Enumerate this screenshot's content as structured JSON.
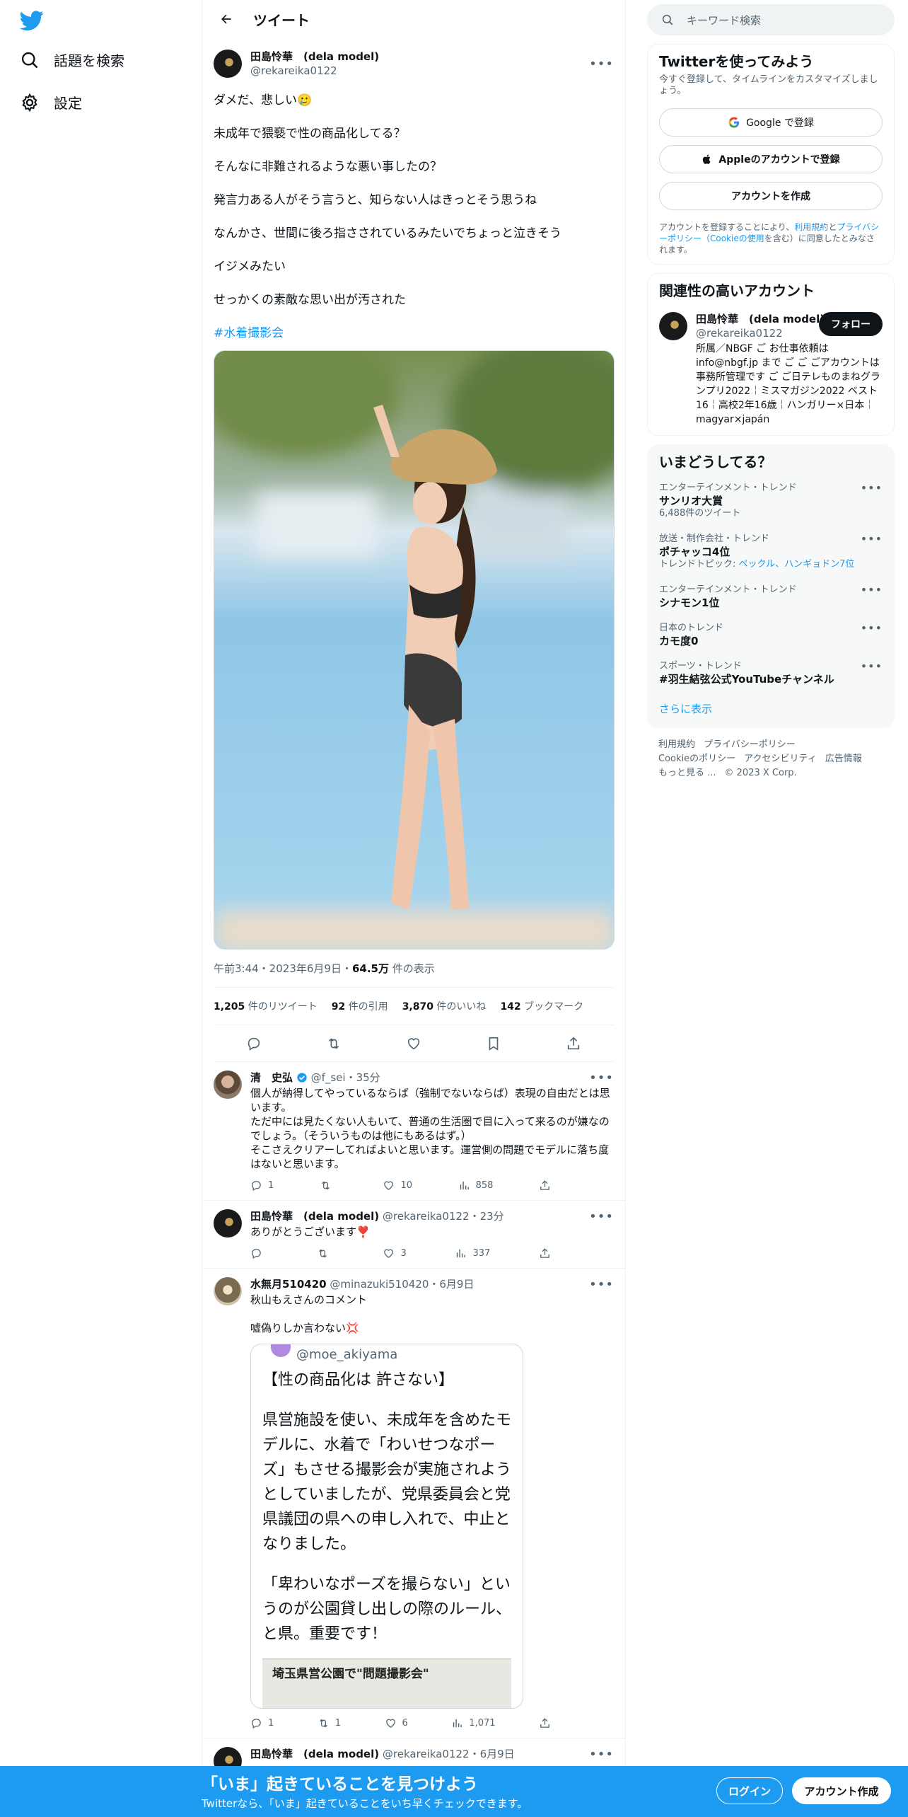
{
  "nav": {
    "explore_label": "話題を検索",
    "settings_label": "設定"
  },
  "header": {
    "title": "ツイート"
  },
  "tweet": {
    "display_name": "田島怜華　(dela model)",
    "handle": "@rekareika0122",
    "lines": [
      "ダメだ、悲しい🥲",
      "未成年で猥褻で性の商品化してる？",
      "そんなに非難されるような悪い事したの？",
      "発言力ある人がそう言うと、知らない人はきっとそう思うね",
      "なんかさ、世間に後ろ指さされているみたいでちょっと泣きそう",
      "イジメみたい",
      "せっかくの素敵な思い出が汚された"
    ],
    "hashtag": "#水着撮影会",
    "time": "午前3:44・2023年6月9日・",
    "views_count": "64.5万",
    "views_label": " 件の表示",
    "stats": [
      {
        "count": "1,205",
        "label": " 件のリツイート"
      },
      {
        "count": "92",
        "label": " 件の引用"
      },
      {
        "count": "3,870",
        "label": " 件のいいね"
      },
      {
        "count": "142",
        "label": " ブックマーク"
      }
    ]
  },
  "replies": [
    {
      "name": "清　史弘",
      "handle": "@f_sei",
      "time": "・35分",
      "body": "個人が納得してやっているならば（強制でないならば）表現の自由だとは思います。\nただ中には見たくない人もいて、普通の生活圏で目に入って来るのが嫌なのでしょう。（そういうものは他にもあるはず。）\nそこさえクリアーしてればよいと思います。運営側の問題でモデルに落ち度はないと思います。",
      "replies": "1",
      "retweets": "",
      "likes": "10",
      "views": "858"
    },
    {
      "name": "田島怜華　(dela model)",
      "handle": "@rekareika0122",
      "time": "・23分",
      "body": "ありがとうございます❣️",
      "replies": "",
      "retweets": "",
      "likes": "3",
      "views": "337"
    },
    {
      "name": "水無月510420",
      "handle": "@minazuki510420",
      "time": "・6月9日",
      "body": "秋山もえさんのコメント\n\n嘘偽りしか言わない💢",
      "replies": "1",
      "retweets": "1",
      "likes": "6",
      "views": "1,071",
      "quote": {
        "handle": "@moe_akiyama",
        "lines": [
          "【性の商品化は 許さない】",
          "県営施設を使い、未成年を含めたモデルに、水着で「わいせつなポーズ」もさせる撮影会が実施されようとしていましたが、党県委員会と党県議団の県への申し入れで、中止となりました。",
          "「卑わいなポーズを撮らない」というのが公園貸し出しの際のルール、と県。重要です！"
        ],
        "newspaper_headline": "埼玉県営公園で\"問題撮影会\""
      }
    },
    {
      "name": "田島怜華　(dela model)",
      "handle": "@rekareika0122",
      "time": "・6月9日"
    }
  ],
  "sidebar": {
    "search_placeholder": "キーワード検索",
    "signup": {
      "title": "Twitterを使ってみよう",
      "sub": "今すぐ登録して、タイムラインをカスタマイズしましょう。",
      "google": "Google で登録",
      "apple": "Appleのアカウントで登録",
      "create": "アカウントを作成",
      "legal_prefix": "アカウントを登録することにより、",
      "legal_terms": "利用規約",
      "legal_and": "と",
      "legal_privacy": "プライバシーポリシー（Cookieの使用",
      "legal_suffix": "を含む）に同意したとみなされます。"
    },
    "relevant": {
      "title": "関連性の高いアカウント",
      "name": "田島怜華　(dela model)",
      "handle": "@rekareika0122",
      "follow": "フォロー",
      "bio": "所属／NBGF ご お仕事依頼は info@nbgf.jp まで ご ご ごアカウントは事務所管理です ご ご日テレものまねグランプリ2022￤ミスマガジン2022 ベスト16￤高校2年16歳￤ハンガリー×日本￤magyar×japán"
    },
    "trends": {
      "title": "いまどうしてる？",
      "items": [
        {
          "cat": "エンターテインメント・トレンド",
          "name": "サンリオ大賞",
          "extra": "6,488件のツイート"
        },
        {
          "cat": "放送・制作会社・トレンド",
          "name": "ポチャッコ4位",
          "extra_prefix": "トレンドトピック: ",
          "extra_links": "ペックル、ハンギョドン7位"
        },
        {
          "cat": "エンターテインメント・トレンド",
          "name": "シナモン1位"
        },
        {
          "cat": "日本のトレンド",
          "name": "カモ度0"
        },
        {
          "cat": "スポーツ・トレンド",
          "name": "#羽生結弦公式YouTubeチャンネル"
        }
      ],
      "show_more": "さらに表示"
    },
    "footer": {
      "row1": [
        "利用規約",
        "プライバシーポリシー"
      ],
      "row2": [
        "Cookieのポリシー",
        "アクセシビリティ",
        "広告情報"
      ],
      "row3": [
        "もっと見る ...",
        "© 2023 X Corp."
      ]
    }
  },
  "bottombar": {
    "headline": "「いま」起きていることを見つけよう",
    "sub": "Twitterなら、「いま」起きていることをいち早くチェックできます。",
    "login": "ログイン",
    "signup": "アカウント作成"
  },
  "colors": {
    "accent": "#1d9bf0",
    "text": "#0f1419",
    "muted": "#536471"
  }
}
